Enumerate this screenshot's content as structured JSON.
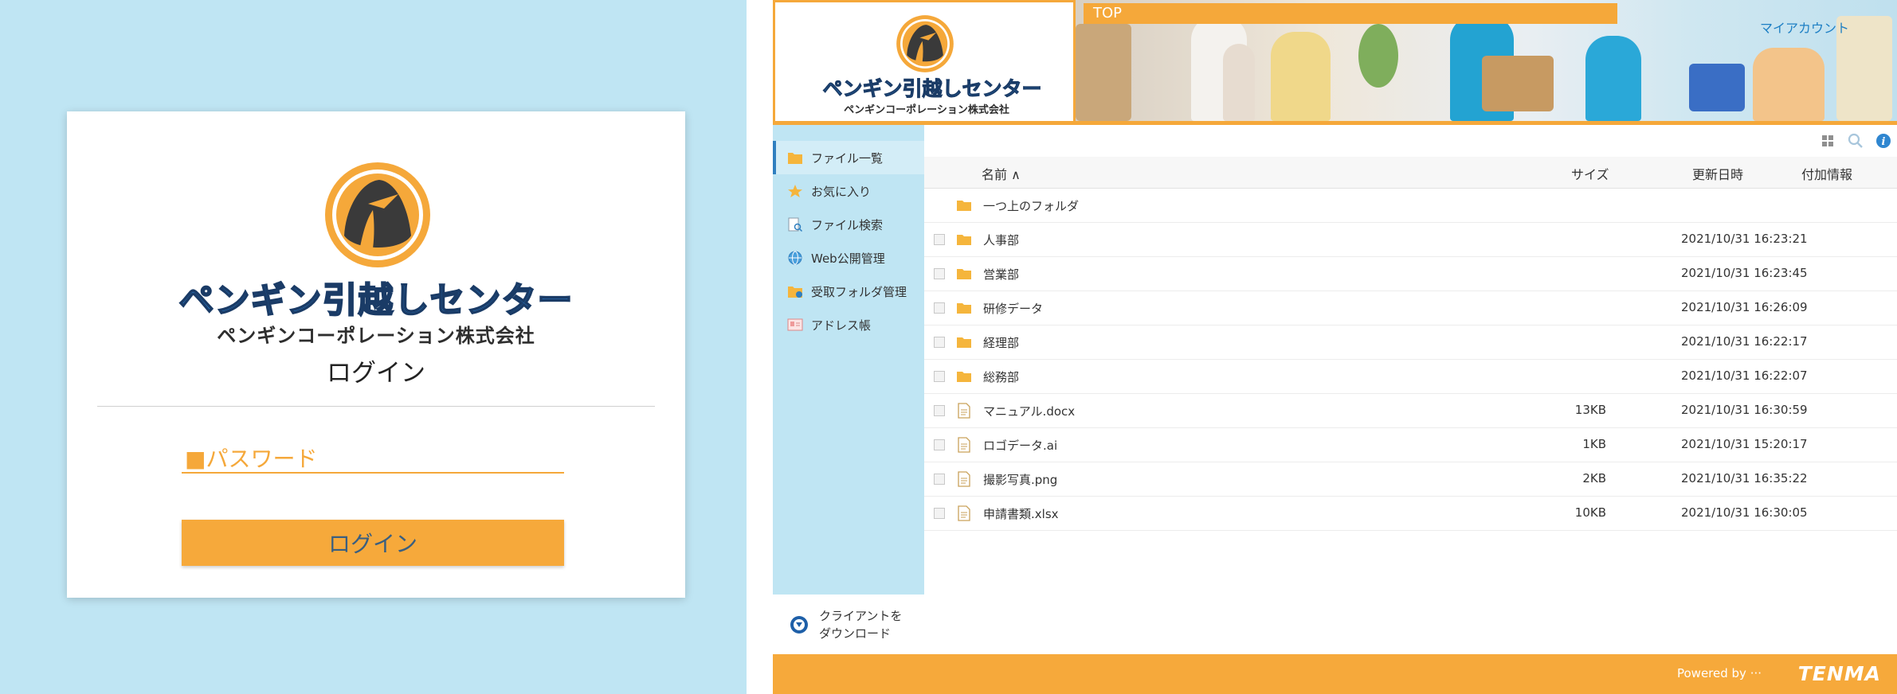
{
  "login": {
    "logo": {
      "title": "ペンギン引越しセンター",
      "subtitle": "ペンギンコーポレーション株式会社"
    },
    "heading": "ログイン",
    "password_placeholder": "■パスワード",
    "button_label": "ログイン"
  },
  "colors": {
    "accent": "#f5a83a",
    "sky": "#bfe5f3",
    "link": "#1d7fc4"
  },
  "header": {
    "logo": {
      "title": "ペンギン引越しセンター",
      "subtitle": "ペンギンコーポレーション株式会社"
    },
    "top_tab": "TOP",
    "my_account": "マイアカウント"
  },
  "sidebar": {
    "items": [
      {
        "label": "ファイル一覧",
        "icon": "folder-icon"
      },
      {
        "label": "お気に入り",
        "icon": "star-icon"
      },
      {
        "label": "ファイル検索",
        "icon": "file-search-icon"
      },
      {
        "label": "Web公開管理",
        "icon": "globe-icon"
      },
      {
        "label": "受取フォルダ管理",
        "icon": "inbox-folder-icon"
      },
      {
        "label": "アドレス帳",
        "icon": "address-book-icon"
      }
    ],
    "client_download_line1": "クライアントを",
    "client_download_line2": "ダウンロード"
  },
  "list": {
    "columns": {
      "name": "名前 ∧",
      "size": "サイズ",
      "date": "更新日時",
      "info": "付加情報"
    },
    "up_folder": "一つ上のフォルダ",
    "rows": [
      {
        "name": "人事部",
        "type": "folder",
        "size": "",
        "date": "2021/10/31 16:23:21"
      },
      {
        "name": "営業部",
        "type": "folder",
        "size": "",
        "date": "2021/10/31 16:23:45"
      },
      {
        "name": "研修データ",
        "type": "folder",
        "size": "",
        "date": "2021/10/31 16:26:09"
      },
      {
        "name": "経理部",
        "type": "folder",
        "size": "",
        "date": "2021/10/31 16:22:17"
      },
      {
        "name": "総務部",
        "type": "folder",
        "size": "",
        "date": "2021/10/31 16:22:07"
      },
      {
        "name": "マニュアル.docx",
        "type": "file",
        "size": "13KB",
        "date": "2021/10/31 16:30:59"
      },
      {
        "name": "ロゴデータ.ai",
        "type": "file",
        "size": "1KB",
        "date": "2021/10/31 15:20:17"
      },
      {
        "name": "撮影写真.png",
        "type": "file",
        "size": "2KB",
        "date": "2021/10/31 16:35:22"
      },
      {
        "name": "申請書類.xlsx",
        "type": "file",
        "size": "10KB",
        "date": "2021/10/31 16:30:05"
      }
    ]
  },
  "footer": {
    "powered_by": "Powered by ···",
    "brand": "TENMA"
  }
}
